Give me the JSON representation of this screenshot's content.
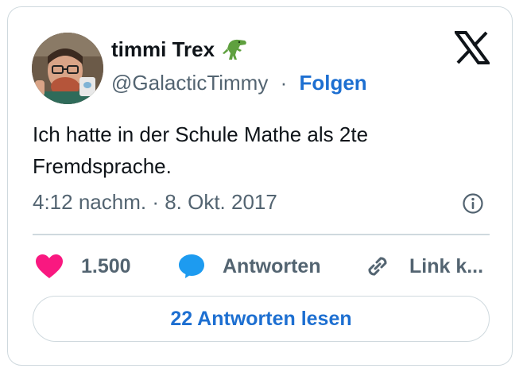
{
  "author": {
    "display_name": "timmi Trex",
    "name_emoji_icon": "t-rex-emoji-icon",
    "handle": "@GalacticTimmy",
    "separator": "·",
    "follow_label": "Folgen"
  },
  "tweet": {
    "text": "Ich hatte in der Schule Mathe als 2te Fremdsprache.",
    "timestamp": "4:12 nachm. · 8. Okt. 2017"
  },
  "actions": {
    "like_count": "1.500",
    "reply_label": "Antworten",
    "link_label": "Link k..."
  },
  "footer": {
    "read_replies_label": "22 Antworten lesen"
  },
  "colors": {
    "link_blue": "#1d6fd1",
    "heart_pink": "#f91880",
    "reply_blue": "#1d9bf0",
    "text_dark": "#0f1419",
    "text_gray": "#536471",
    "border": "#cfd9de"
  }
}
